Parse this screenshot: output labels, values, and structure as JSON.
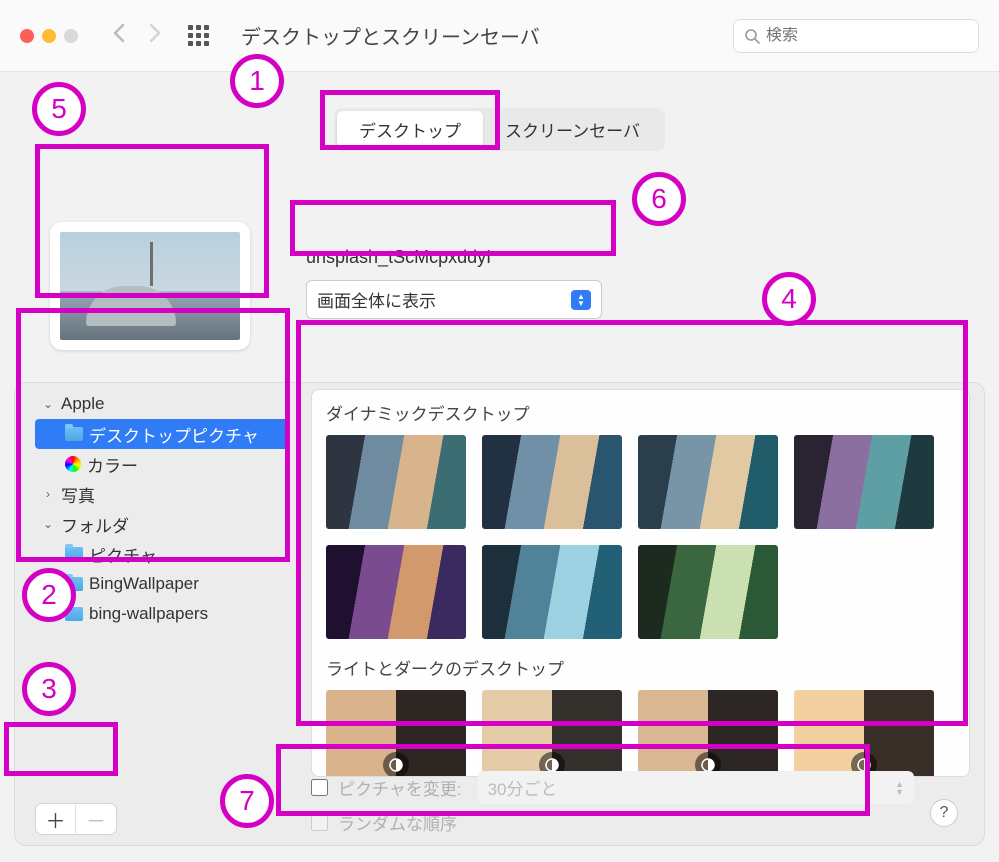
{
  "titlebar": {
    "window_title": "デスクトップとスクリーンセーバ",
    "search_placeholder": "検索"
  },
  "tabs": {
    "desktop": "デスクトップ",
    "screensaver": "スクリーンセーバ"
  },
  "preview": {
    "filename": "unsplash_tScMcpxddyI",
    "fit_mode": "画面全体に表示"
  },
  "sidebar": {
    "apple_group": "Apple",
    "desktop_pictures": "デスクトップピクチャ",
    "colors": "カラー",
    "photos_group": "写真",
    "folders_group": "フォルダ",
    "folders": [
      {
        "label": "ピクチャ"
      },
      {
        "label": "BingWallpaper"
      },
      {
        "label": "bing-wallpapers"
      }
    ]
  },
  "sections": {
    "dynamic": "ダイナミックデスクトップ",
    "light_dark": "ライトとダークのデスクトップ"
  },
  "options": {
    "change_picture_label": "ピクチャを変更:",
    "interval": "30分ごと",
    "random_label": "ランダムな順序"
  },
  "annotations": {
    "n1": "1",
    "n2": "2",
    "n3": "3",
    "n4": "4",
    "n5": "5",
    "n6": "6",
    "n7": "7"
  },
  "help": "?"
}
